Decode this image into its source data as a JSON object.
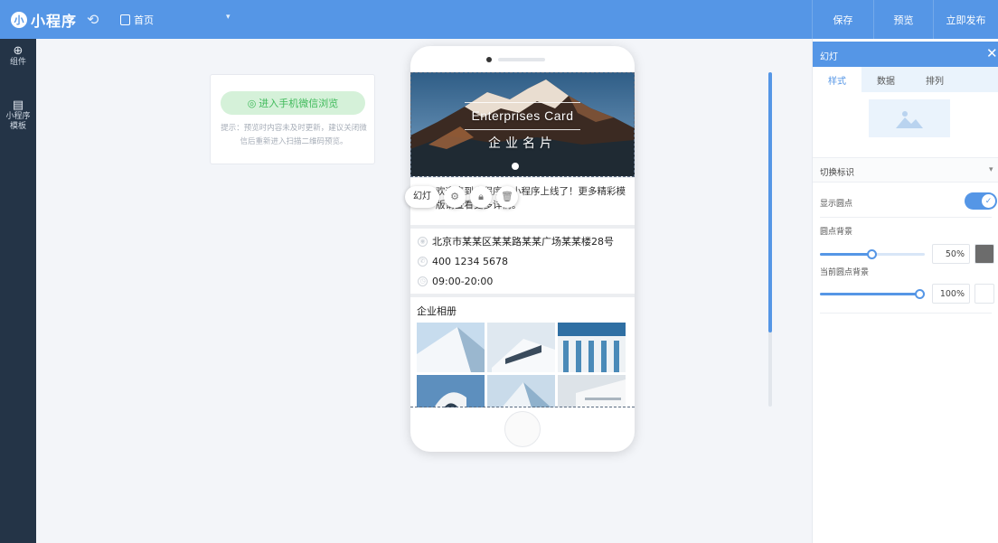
{
  "header": {
    "logo_mark": "小",
    "logo_text": "小程序",
    "undo_icon": "undo-icon",
    "page_label": "首页",
    "buttons": [
      "保存",
      "预览",
      "立即发布"
    ]
  },
  "sidebar": {
    "items": [
      {
        "icon": "plus-circle-icon",
        "label": "组件"
      },
      {
        "icon": "document-icon",
        "label": "小程序",
        "label2": "模板"
      }
    ]
  },
  "preview": {
    "button": "进入手机微信浏览",
    "tip": "提示：预览时内容未及时更新，建议关闭微信后重新进入扫描二维码预览。"
  },
  "phone": {
    "banner": {
      "title_en": "Enterprises Card",
      "title_cn": "企业名片"
    },
    "notice": "欢迎来到小程序，小程序上线了！更多精彩模版请查看更多详情。",
    "info": [
      {
        "icon": "location-icon",
        "text": "北京市某某区某某路某某广场某某楼28号"
      },
      {
        "icon": "phone-icon",
        "text": "400 1234 5678"
      },
      {
        "icon": "clock-icon",
        "text": "09:00-20:00"
      }
    ],
    "album_title": "企业相册"
  },
  "toolbar": {
    "label": "幻灯",
    "buttons": [
      "settings-icon",
      "lock-icon",
      "trash-icon"
    ]
  },
  "panel": {
    "title": "幻灯",
    "tabs": [
      "样式",
      "数据",
      "排列"
    ],
    "active_tab": "样式",
    "section_title": "切换标识",
    "show_dots_label": "显示圆点",
    "show_dots": true,
    "dot_bg_label": "圆点背景",
    "dot_bg_value": "50%",
    "dot_bg_percent": 50,
    "current_dot_bg_label": "当前圆点背景",
    "current_dot_bg_value": "100%",
    "current_dot_bg_percent": 100
  },
  "colors": {
    "accent": "#5596e6",
    "sidebar": "#243447",
    "green": "#3fba5a"
  }
}
